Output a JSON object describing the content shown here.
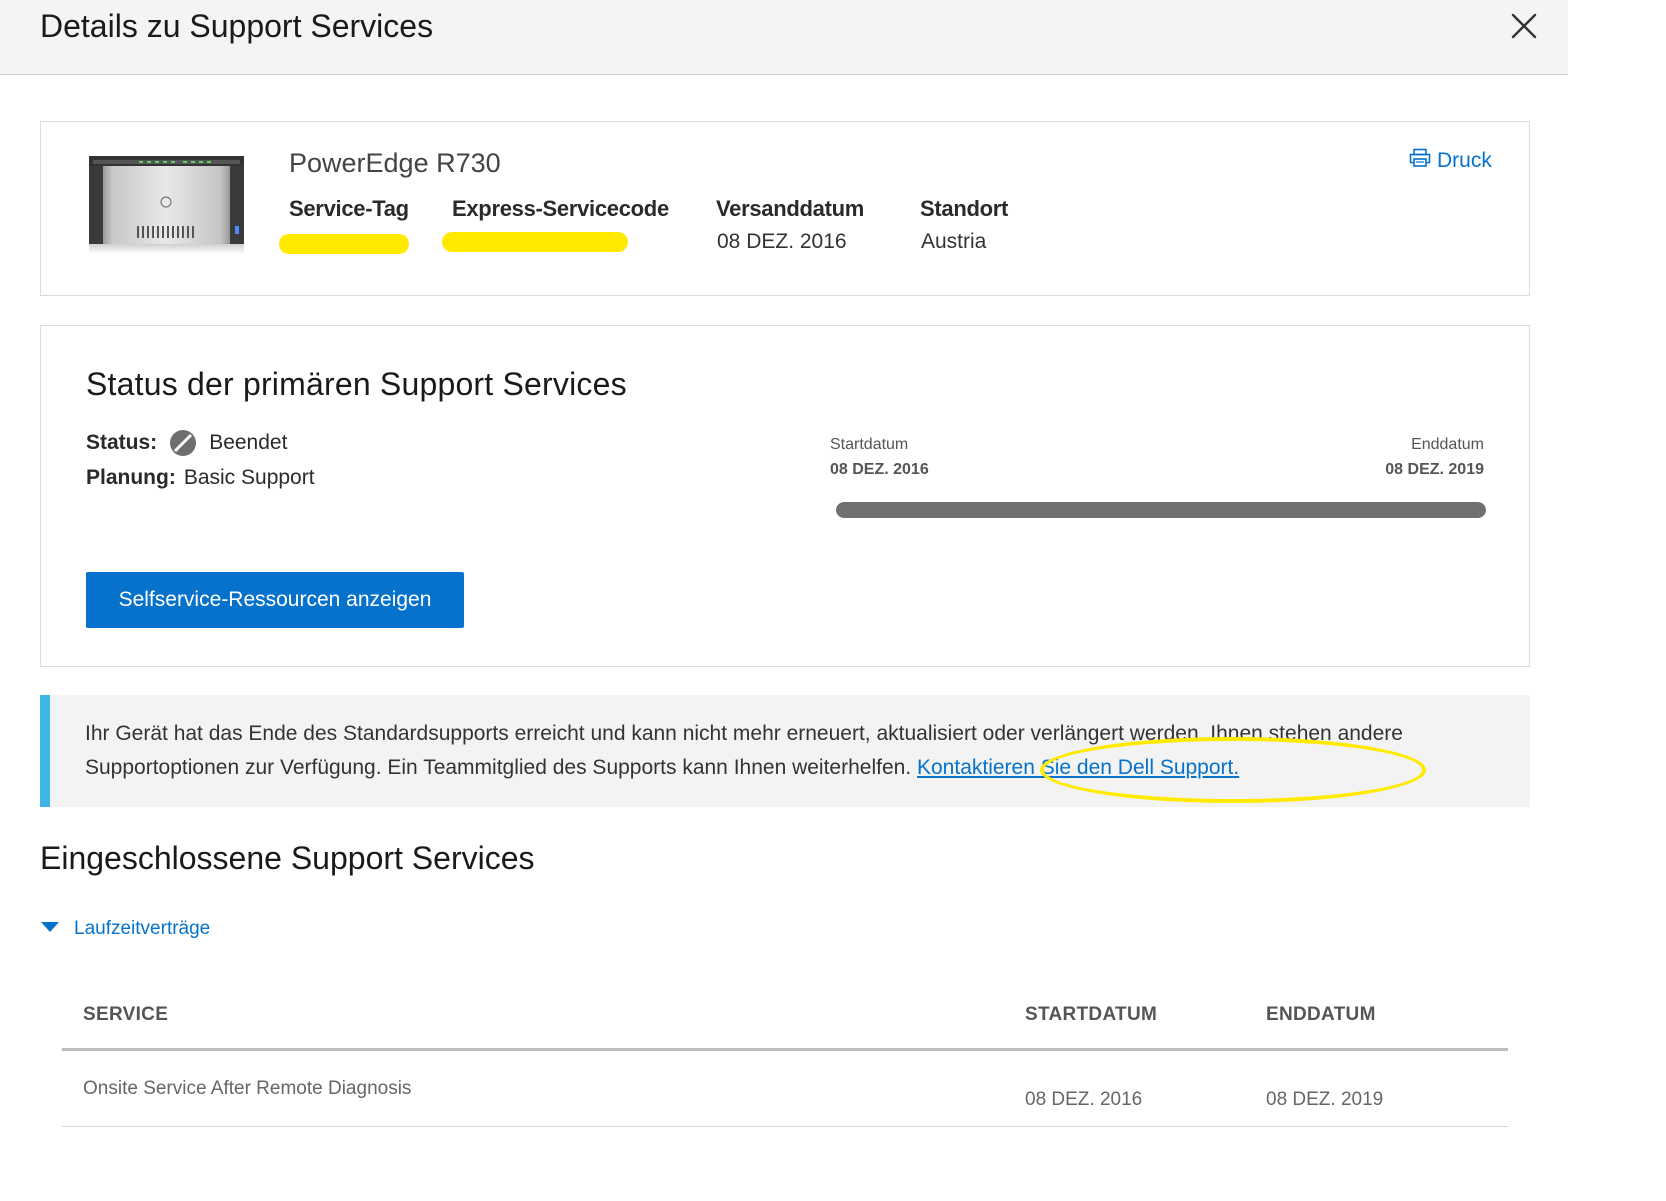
{
  "header": {
    "title": "Details zu Support Services",
    "close_icon": "close-icon"
  },
  "product": {
    "name": "PowerEdge R730",
    "print_label": "Druck",
    "print_icon": "printer-icon",
    "service_tag_label": "Service-Tag",
    "express_code_label": "Express-Servicecode",
    "ship_date_label": "Versanddatum",
    "ship_date_value": "08 DEZ. 2016",
    "location_label": "Standort",
    "location_value": "Austria",
    "highlight_color": "#ffea00"
  },
  "status": {
    "title": "Status der primären Support Services",
    "status_label": "Status:",
    "status_value": "Beendet",
    "status_icon": "ended-icon",
    "plan_label": "Planung:",
    "plan_value": "Basic Support",
    "start_label": "Startdatum",
    "start_value": "08 DEZ. 2016",
    "end_label": "Enddatum",
    "end_value": "08 DEZ. 2019",
    "progress_fraction": 1.0,
    "button_label": "Selfservice-Ressourcen anzeigen"
  },
  "notice": {
    "text": "Ihr Gerät hat das Ende des Standardsupports erreicht und kann nicht mehr erneuert, aktualisiert oder verlängert werden. Ihnen stehen andere Supportoptionen zur Verfügung. Ein Teammitglied des Supports kann Ihnen weiterhelfen.",
    "link_label": "Kontaktieren Sie den Dell Support.",
    "accent_color": "#41b6e6"
  },
  "included": {
    "title": "Eingeschlossene Support Services",
    "accordion_label": "Laufzeitverträge",
    "accordion_icon": "caret-down-icon",
    "columns": [
      "SERVICE",
      "STARTDATUM",
      "ENDDATUM"
    ],
    "rows": [
      {
        "service": "Onsite Service After Remote Diagnosis",
        "start": "08 DEZ. 2016",
        "end": "08 DEZ. 2019"
      }
    ]
  },
  "colors": {
    "brand_blue": "#0672cb"
  }
}
